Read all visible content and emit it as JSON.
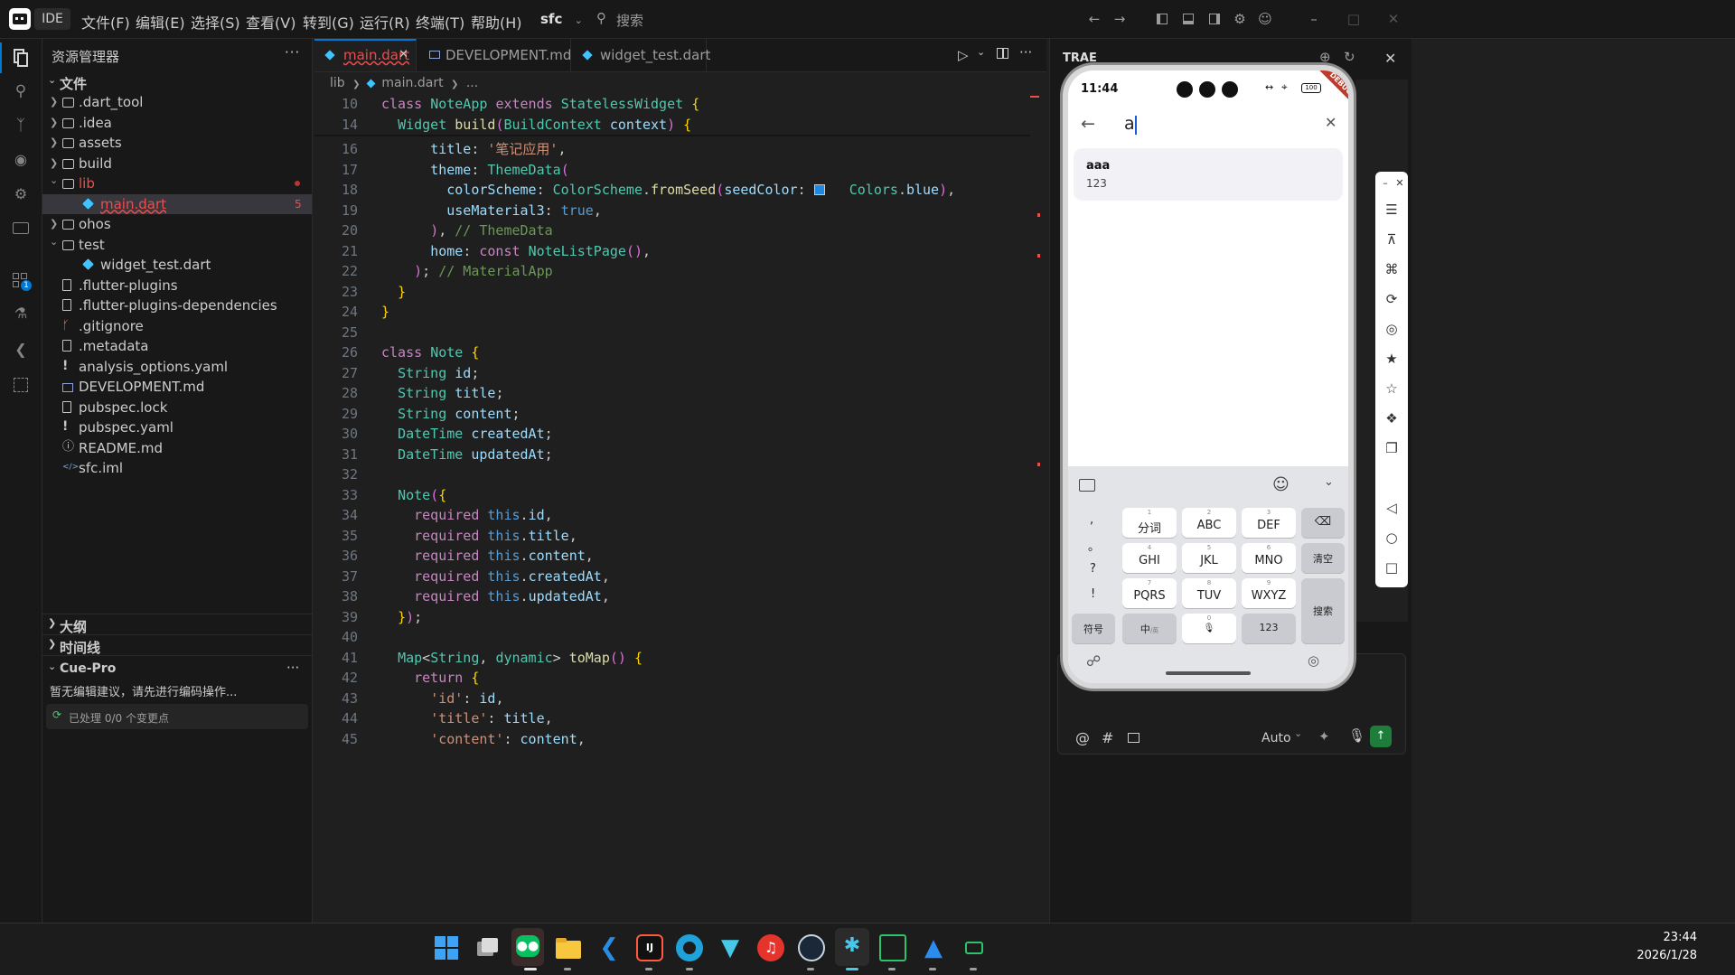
{
  "titlebar": {
    "app_label": "IDE",
    "menus": [
      "文件(F)",
      "编辑(E)",
      "选择(S)",
      "查看(V)",
      "转到(G)",
      "运行(R)",
      "终端(T)",
      "帮助(H)"
    ],
    "project": "sfc",
    "search_placeholder": "搜索"
  },
  "sidebar": {
    "title": "资源管理器",
    "section": "文件",
    "items": [
      {
        "label": ".dart_tool",
        "kind": "folder",
        "depth": 0,
        "open": false
      },
      {
        "label": ".idea",
        "kind": "folder",
        "depth": 0,
        "open": false
      },
      {
        "label": "assets",
        "kind": "folder",
        "depth": 0,
        "open": false
      },
      {
        "label": "build",
        "kind": "folder",
        "depth": 0,
        "open": false
      },
      {
        "label": "lib",
        "kind": "folder",
        "depth": 0,
        "open": true
      },
      {
        "label": "main.dart",
        "kind": "dart",
        "depth": 1,
        "badge": "5"
      },
      {
        "label": "ohos",
        "kind": "folder",
        "depth": 0,
        "open": false
      },
      {
        "label": "test",
        "kind": "folder",
        "depth": 0,
        "open": true
      },
      {
        "label": "widget_test.dart",
        "kind": "dart",
        "depth": 1
      },
      {
        "label": ".flutter-plugins",
        "kind": "file",
        "depth": 0
      },
      {
        "label": ".flutter-plugins-dependencies",
        "kind": "file",
        "depth": 0
      },
      {
        "label": ".gitignore",
        "kind": "git",
        "depth": 0
      },
      {
        "label": ".metadata",
        "kind": "file",
        "depth": 0
      },
      {
        "label": "analysis_options.yaml",
        "kind": "yaml",
        "depth": 0
      },
      {
        "label": "DEVELOPMENT.md",
        "kind": "md",
        "depth": 0
      },
      {
        "label": "pubspec.lock",
        "kind": "file",
        "depth": 0
      },
      {
        "label": "pubspec.yaml",
        "kind": "yaml",
        "depth": 0
      },
      {
        "label": "README.md",
        "kind": "info",
        "depth": 0
      },
      {
        "label": "sfc.iml",
        "kind": "code",
        "depth": 0
      }
    ],
    "outline_label": "大纲",
    "timeline_label": "时间线",
    "cue_title": "Cue-Pro",
    "cue_message": "暂无编辑建议，请先进行编码操作...",
    "cue_status": "已处理 0/0 个变更点"
  },
  "editor": {
    "tabs": [
      {
        "label": "main.dart",
        "active": true
      },
      {
        "label": "DEVELOPMENT.md",
        "active": false
      },
      {
        "label": "widget_test.dart",
        "active": false
      }
    ],
    "breadcrumb": {
      "folder": "lib",
      "file": "main.dart",
      "more": "..."
    },
    "sticky": [
      {
        "num": "10",
        "text": "class NoteApp extends StatelessWidget {"
      },
      {
        "num": "14",
        "text": "  Widget build(BuildContext context) {"
      }
    ],
    "lines": [
      {
        "num": "16",
        "text": "      title: '笔记应用',"
      },
      {
        "num": "17",
        "text": "      theme: ThemeData("
      },
      {
        "num": "18",
        "text": "        colorScheme: ColorScheme.fromSeed(seedColor:   Colors.blue),"
      },
      {
        "num": "19",
        "text": "        useMaterial3: true,"
      },
      {
        "num": "20",
        "text": "      ), // ThemeData"
      },
      {
        "num": "21",
        "text": "      home: const NoteListPage(),"
      },
      {
        "num": "22",
        "text": "    ); // MaterialApp"
      },
      {
        "num": "23",
        "text": "  }"
      },
      {
        "num": "24",
        "text": "}"
      },
      {
        "num": "25",
        "text": ""
      },
      {
        "num": "26",
        "text": "class Note {"
      },
      {
        "num": "27",
        "text": "  String id;"
      },
      {
        "num": "28",
        "text": "  String title;"
      },
      {
        "num": "29",
        "text": "  String content;"
      },
      {
        "num": "30",
        "text": "  DateTime createdAt;"
      },
      {
        "num": "31",
        "text": "  DateTime updatedAt;"
      },
      {
        "num": "32",
        "text": ""
      },
      {
        "num": "33",
        "text": "  Note({"
      },
      {
        "num": "34",
        "text": "    required this.id,"
      },
      {
        "num": "35",
        "text": "    required this.title,"
      },
      {
        "num": "36",
        "text": "    required this.content,"
      },
      {
        "num": "37",
        "text": "    required this.createdAt,"
      },
      {
        "num": "38",
        "text": "    required this.updatedAt,"
      },
      {
        "num": "39",
        "text": "  });"
      },
      {
        "num": "40",
        "text": ""
      },
      {
        "num": "41",
        "text": "  Map<String, dynamic> toMap() {"
      },
      {
        "num": "42",
        "text": "    return {"
      },
      {
        "num": "43",
        "text": "      'id': id,"
      },
      {
        "num": "44",
        "text": "      'title': title,"
      },
      {
        "num": "45",
        "text": "      'content': content,"
      }
    ]
  },
  "right_panel": {
    "title": "TRAE",
    "mode": "Auto"
  },
  "emulator": {
    "time": "11:44",
    "battery": "100",
    "debug_label": "DEBUG",
    "search_text": "a",
    "result_title": "aaa",
    "result_subtitle": "123",
    "keyboard": {
      "punct": [
        ",",
        "。",
        "?",
        "!"
      ],
      "rows": [
        [
          {
            "n": "1",
            "l": "分词"
          },
          {
            "n": "2",
            "l": "ABC"
          },
          {
            "n": "3",
            "l": "DEF"
          }
        ],
        [
          {
            "n": "4",
            "l": "GHI"
          },
          {
            "n": "5",
            "l": "JKL"
          },
          {
            "n": "6",
            "l": "MNO"
          }
        ],
        [
          {
            "n": "7",
            "l": "PQRS"
          },
          {
            "n": "8",
            "l": "TUV"
          },
          {
            "n": "9",
            "l": "WXYZ"
          }
        ]
      ],
      "clear": "清空",
      "search": "搜索",
      "symbols": "符号",
      "lang": "中",
      "lang_sub": "/英",
      "zero": "0",
      "num_mode": "123"
    }
  },
  "taskbar": {
    "time": "23:44",
    "date": "2026/1/28"
  },
  "colors": {
    "accent": "#0078d4",
    "error": "#f14c4c",
    "dart": "#40c4ff",
    "wechat": "#07c160"
  }
}
